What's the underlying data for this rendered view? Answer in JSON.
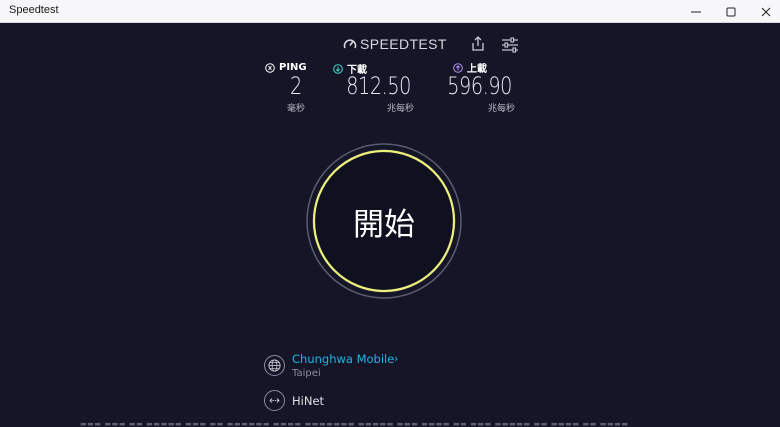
{
  "window": {
    "title": "Speedtest"
  },
  "header": {
    "logo_text": "SPEEDTEST",
    "logo_icon": "gauge-icon",
    "share_icon": "share-icon",
    "settings_icon": "sliders-icon"
  },
  "metrics": {
    "ping": {
      "label": "PING",
      "value": "2",
      "unit": "毫秒"
    },
    "download": {
      "label": "下載",
      "value": "812.50",
      "unit": "兆每秒"
    },
    "upload": {
      "label": "上載",
      "value": "596.90",
      "unit": "兆每秒"
    }
  },
  "go_button": {
    "label": "開始"
  },
  "connection": {
    "isp_name": "Chunghwa Mobile",
    "isp_location": "Taipei",
    "server_name": "HiNet"
  },
  "colors": {
    "background": "#141526",
    "ring_yellow": "#ecf07a",
    "ping_accent": "#ffffff",
    "download_accent": "#45d8c8",
    "upload_accent": "#b98ff5",
    "link": "#1eb4e8"
  }
}
